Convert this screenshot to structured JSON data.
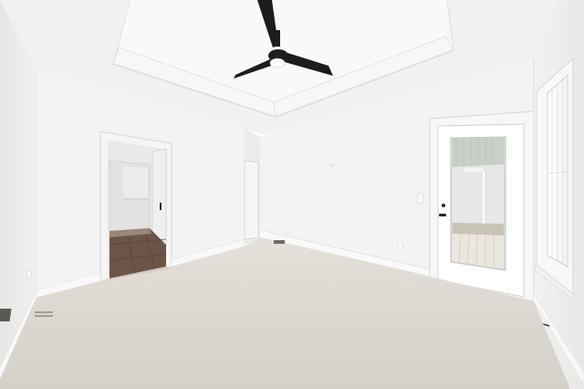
{
  "scene": {
    "subject": "empty-bedroom-interior",
    "elements": [
      "tray-ceiling",
      "ceiling-fan",
      "open-doorway",
      "glass-panel-door",
      "window",
      "carpet-floor",
      "floor-vent",
      "wall-outlet",
      "light-switch"
    ]
  },
  "colors": {
    "ceiling": "#f2f2f1",
    "wall_left": "#eeeeed",
    "wall_back": "#f3f3f2",
    "wall_right": "#f0f0ef",
    "carpet": "#ddd8d1",
    "trim": "#fafafa",
    "fan_black": "#1c1c1c",
    "tile_floor": "#6a5546",
    "door_glass": "#d9ddd8"
  }
}
